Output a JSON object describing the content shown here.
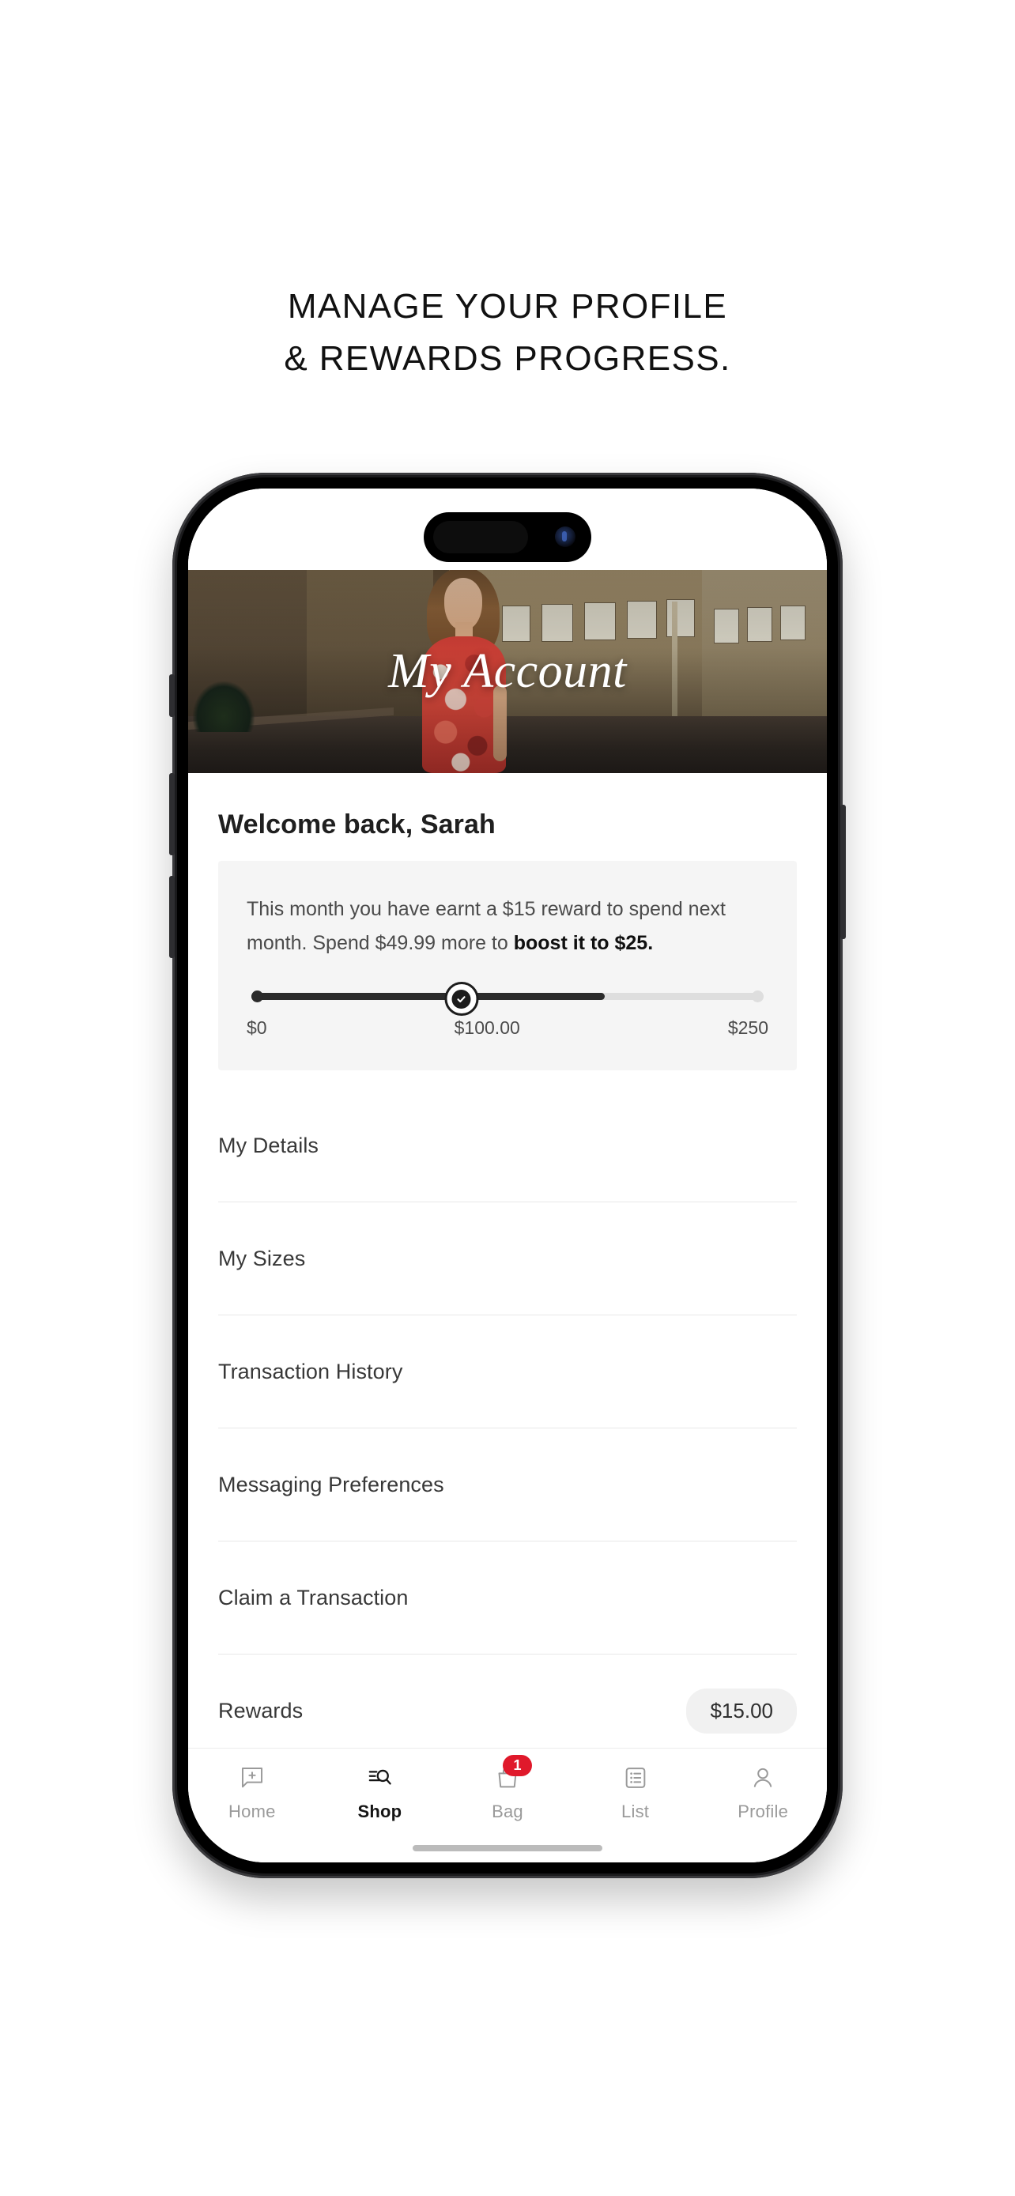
{
  "page": {
    "heading_line1": "MANAGE YOUR PROFILE",
    "heading_line2": "& REWARDS PROGRESS."
  },
  "app": {
    "hero": {
      "title": "My Account",
      "image_alt": "woman-in-red-floral-dress-on-city-street"
    },
    "welcome": "Welcome back, Sarah",
    "reward_card": {
      "text_part1": "This month you have earnt a $15 reward to spend next month. Spend $49.99 more to ",
      "text_bold": "boost it to $25.",
      "slider": {
        "min_label": "$0",
        "mid_label": "$100.00",
        "max_label": "$250",
        "fill_percent": 69,
        "milestone_percent": 41,
        "milestone_icon": "check-circle-icon",
        "fill_color": "#2b2b2b",
        "track_color": "#dedede"
      }
    },
    "menu": [
      {
        "label": "My Details",
        "badge": null
      },
      {
        "label": "My Sizes",
        "badge": null
      },
      {
        "label": "Transaction History",
        "badge": null
      },
      {
        "label": "Messaging Preferences",
        "badge": null
      },
      {
        "label": "Claim a Transaction",
        "badge": null
      },
      {
        "label": "Rewards",
        "badge": "$15.00"
      }
    ],
    "tabbar": [
      {
        "label": "Home",
        "icon": "chat-plus-icon",
        "active": false,
        "badge": null
      },
      {
        "label": "Shop",
        "icon": "search-lines-icon",
        "active": true,
        "badge": null
      },
      {
        "label": "Bag",
        "icon": "shopping-bag-icon",
        "active": false,
        "badge": "1"
      },
      {
        "label": "List",
        "icon": "list-icon",
        "active": false,
        "badge": null
      },
      {
        "label": "Profile",
        "icon": "person-icon",
        "active": false,
        "badge": null
      }
    ],
    "badge_color": "#e0192b"
  }
}
